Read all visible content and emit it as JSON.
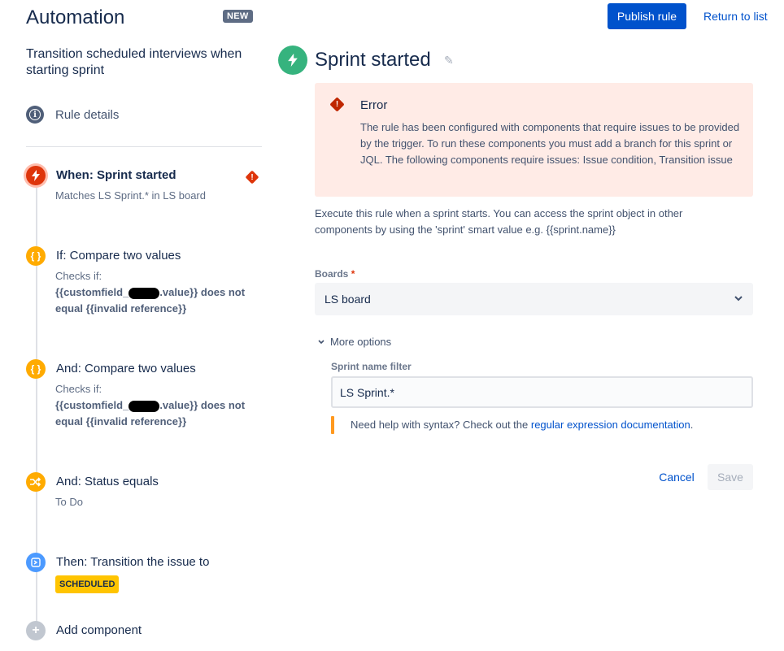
{
  "app": {
    "title": "Automation",
    "badge": "NEW"
  },
  "rule": {
    "name": "Transition scheduled interviews when starting sprint",
    "details_label": "Rule details"
  },
  "components": [
    {
      "kind": "trigger",
      "icon": "lightning-icon",
      "title": "When: Sprint started",
      "subtitle": "Matches LS Sprint.* in LS board",
      "has_error": true
    },
    {
      "kind": "condition",
      "icon": "braces-icon",
      "title": "If: Compare two values",
      "checks_label": "Checks if:",
      "expr_part1": "{{customfield_",
      "expr_part2": ".value}} does not equal {{invalid reference}}"
    },
    {
      "kind": "condition",
      "icon": "braces-icon",
      "title": "And: Compare two values",
      "checks_label": "Checks if:",
      "expr_part1": "{{customfield_",
      "expr_part2": ".value}} does not equal {{invalid reference}}"
    },
    {
      "kind": "condition",
      "icon": "shuffle-icon",
      "title": "And: Status equals",
      "subtitle": "To Do"
    },
    {
      "kind": "action",
      "icon": "transition-icon",
      "title": "Then: Transition the issue to",
      "status": "SCHEDULED"
    }
  ],
  "add_component_label": "Add component",
  "header": {
    "publish_label": "Publish rule",
    "return_label": "Return to list"
  },
  "trigger_panel": {
    "title": "Sprint started",
    "error": {
      "title": "Error",
      "message": "The rule has been configured with components that require issues to be provided by the trigger. To run these components you must add a branch for this sprint or JQL. The following components require issues: Issue condition, Transition issue"
    },
    "description": "Execute this rule when a sprint starts. You can access the sprint object in other components by using the 'sprint' smart value e.g. {{sprint.name}}",
    "boards_label": "Boards",
    "boards_required": "*",
    "boards_value": "LS board",
    "more_options_label": "More options",
    "sprint_filter_label": "Sprint name filter",
    "sprint_filter_value": "LS Sprint.*",
    "help_prefix": "Need help with syntax? Check out the ",
    "help_link": "regular expression documentation",
    "help_suffix": ".",
    "cancel_label": "Cancel",
    "save_label": "Save"
  },
  "colors": {
    "primary": "#0052cc",
    "trigger": "#de350b",
    "condition": "#ffab00",
    "action": "#4c9aff",
    "trigger_main": "#36b37e",
    "error_bg": "#ffebe6",
    "lozenge": "#ffc400"
  }
}
